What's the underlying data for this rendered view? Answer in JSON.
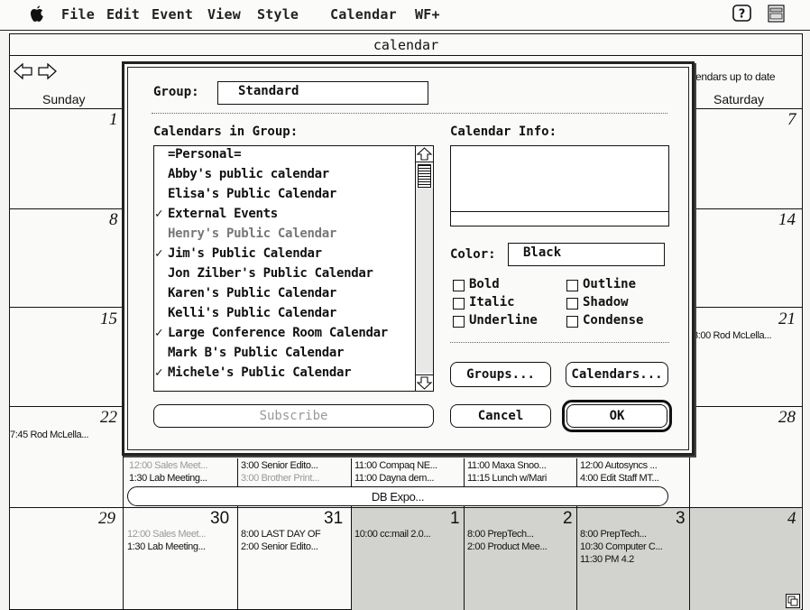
{
  "menubar": {
    "items": [
      "File",
      "Edit",
      "Event",
      "View",
      "Style",
      "Calendar",
      "WF+"
    ]
  },
  "icons": {
    "apple": "apple-icon",
    "help": "help-icon",
    "app": "application-menu-icon",
    "nav_left": "arrow-left-icon",
    "nav_right": "arrow-right-icon",
    "resize": "resize-box-icon",
    "scroll_up": "scroll-up-arrow-icon",
    "scroll_down": "scroll-down-arrow-icon"
  },
  "window": {
    "title": "calendar",
    "status": "endars up to date"
  },
  "calendar": {
    "day_headers": {
      "sunday": "Sunday",
      "saturday": "Saturday"
    },
    "numbers": {
      "r1_sun": "1",
      "r1_sat": "7",
      "r2_sun": "8",
      "r2_sat": "14",
      "r3_sun": "15",
      "r3_sat": "21",
      "r4_sun": "22",
      "r4_sat": "28",
      "r5_sun": "29",
      "r5_mon": "30",
      "r5_tue": "31",
      "r5_wed": "1",
      "r5_thu": "2",
      "r5_fri": "3",
      "r5_sat": "4"
    },
    "events": {
      "r3_sat": "8:00 Rod McLella...",
      "r4_sun": "7:45 Rod McLella...",
      "r4_mon_1": "12:00 Sales Meet...",
      "r4_mon_2": "1:30 Lab Meeting...",
      "r4_tue_1": "3:00 Senior Edito...",
      "r4_tue_2": "3:00 Brother Print...",
      "r4_wed_1": "11:00 Compaq NE...",
      "r4_wed_2": "11:00 Dayna dem...",
      "r4_thu_1": "11:00 Maxa Snoo...",
      "r4_thu_2": "11:15 Lunch w/Mari",
      "r4_fri_1": "12:00 Autosyncs ...",
      "r4_fri_2": "4:00 Edit Staff MT...",
      "banner": "DB Expo...",
      "r5_mon_1": "12:00 Sales Meet...",
      "r5_mon_2": "1:30 Lab Meeting...",
      "r5_tue_1": "8:00 LAST DAY OF",
      "r5_tue_2": "2:00 Senior Edito...",
      "r5_wed_1": "10:00 cc:mail 2.0...",
      "r5_thu_1": "8:00 PrepTech...",
      "r5_thu_2": "2:00 Product Mee...",
      "r5_fri_1": "8:00 PrepTech...",
      "r5_fri_2": "10:30 Computer C...",
      "r5_fri_3": "11:30 PM 4.2"
    }
  },
  "dialog": {
    "group_label": "Group:",
    "group_value": "Standard",
    "list_label": "Calendars in Group:",
    "info_label": "Calendar Info:",
    "calendars": [
      {
        "check": "",
        "name": "=Personal="
      },
      {
        "check": "",
        "name": "Abby's public calendar"
      },
      {
        "check": "",
        "name": "Elisa's Public Calendar"
      },
      {
        "check": "✓",
        "name": "External Events"
      },
      {
        "check": "",
        "name": "Henry's Public Calendar"
      },
      {
        "check": "✓",
        "name": "Jim's Public Calendar"
      },
      {
        "check": "",
        "name": "Jon Zilber's Public Calendar"
      },
      {
        "check": "",
        "name": "Karen's Public Calendar"
      },
      {
        "check": "",
        "name": "Kelli's Public Calendar"
      },
      {
        "check": "✓",
        "name": "Large Conference Room Calendar"
      },
      {
        "check": "",
        "name": "Mark B's Public Calendar"
      },
      {
        "check": "✓",
        "name": "Michele's Public Calendar"
      }
    ],
    "color_label": "Color:",
    "color_value": "Black",
    "styles": {
      "bold": "Bold",
      "italic": "Italic",
      "underline": "Underline",
      "outline": "Outline",
      "shadow": "Shadow",
      "condense": "Condense"
    },
    "buttons": {
      "subscribe": "Subscribe",
      "groups": "Groups...",
      "calendars": "Calendars...",
      "cancel": "Cancel",
      "ok": "OK"
    }
  }
}
